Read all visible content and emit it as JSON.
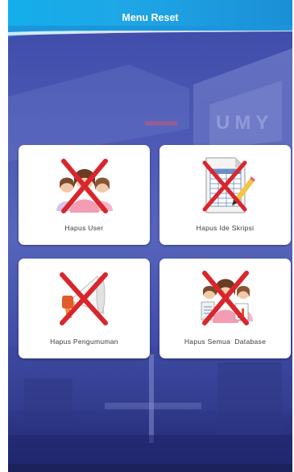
{
  "header": {
    "title": "Menu Reset"
  },
  "background": {
    "watermark_text": "UMY"
  },
  "menu": {
    "items": [
      {
        "label": "Hapus User",
        "icon": "users-cross-icon"
      },
      {
        "label": "Hapus Ide Skripsi",
        "icon": "spreadsheet-cross-icon"
      },
      {
        "label": "Hapus Pengumuman",
        "icon": "megaphone-cross-icon"
      },
      {
        "label": "Hapus Semua  Database",
        "icon": "database-people-cross-icon"
      }
    ]
  },
  "colors": {
    "header": "#1ea7e6",
    "background": "#4a58b4",
    "cross": "#d9262c",
    "card": "#ffffff"
  }
}
